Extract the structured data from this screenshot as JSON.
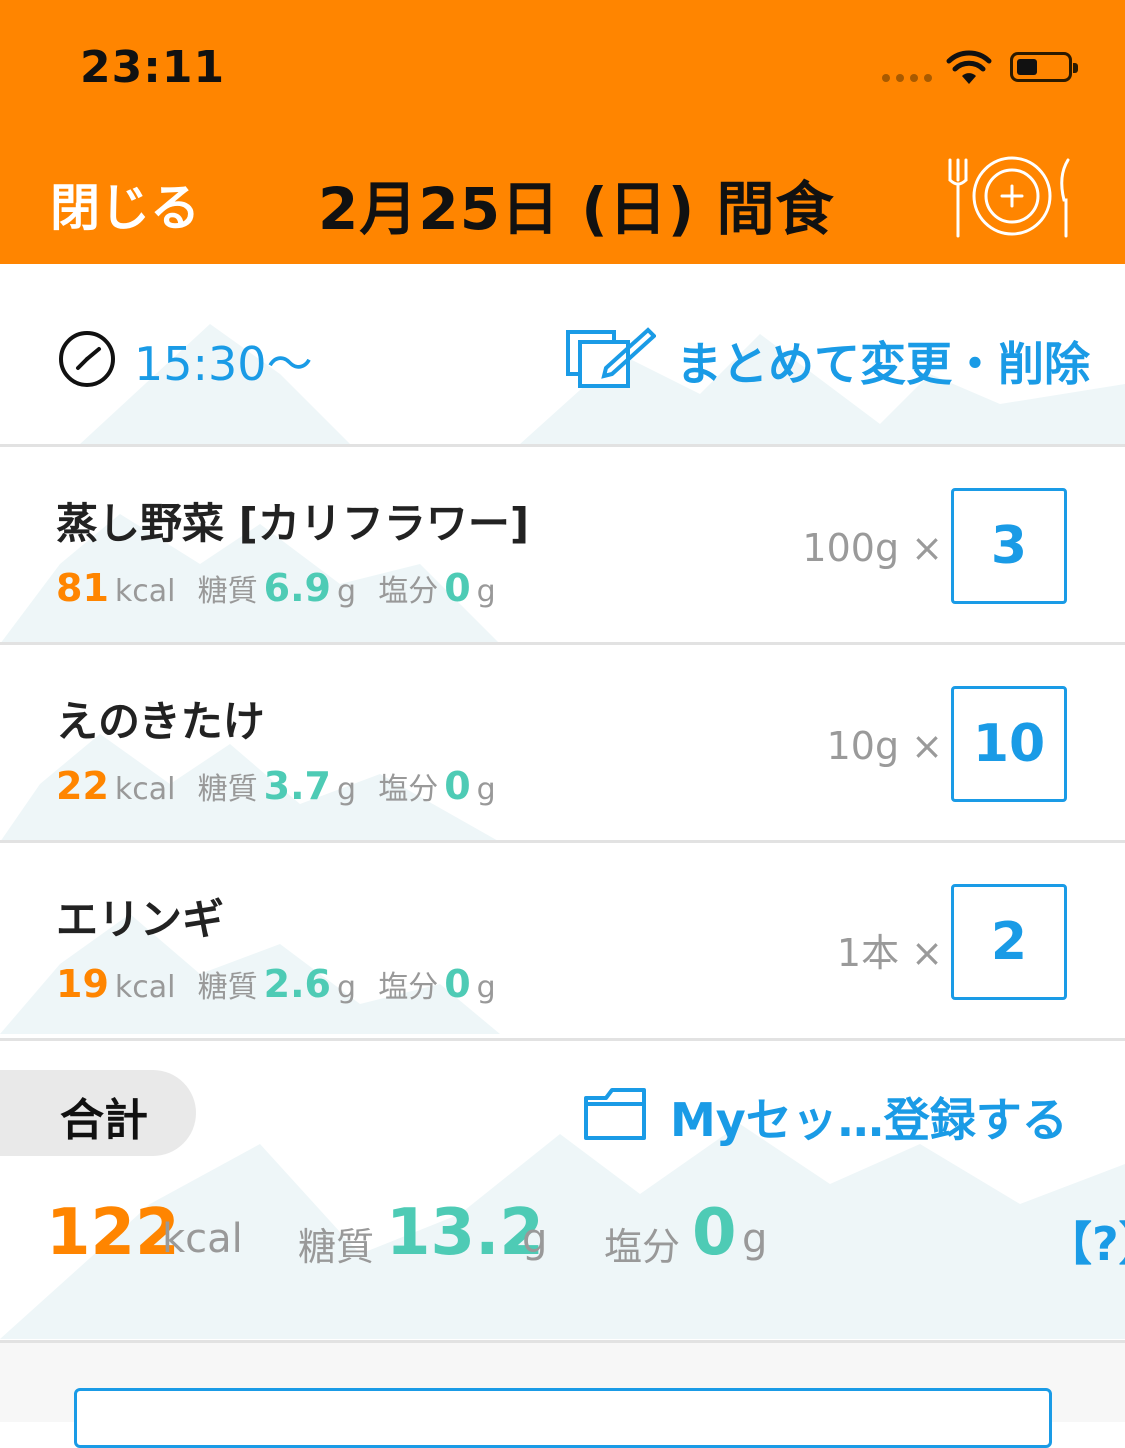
{
  "status_bar": {
    "time": "23:11"
  },
  "header": {
    "close_label": "閉じる",
    "title": "2月25日 (日) 間食",
    "add_icon": "plate-cutlery-plus-icon"
  },
  "meal": {
    "time": "15:30〜",
    "bulk_edit_label": "まとめて変更・削除"
  },
  "labels": {
    "kcal": "kcal",
    "carb": "糖質",
    "salt": "塩分",
    "g": "g"
  },
  "items": [
    {
      "name": "蒸し野菜 [カリフラワー]",
      "kcal": "81",
      "carb": "6.9",
      "salt": "0",
      "unit": "100g ×",
      "qty": "3"
    },
    {
      "name": "えのきたけ",
      "kcal": "22",
      "carb": "3.7",
      "salt": "0",
      "unit": "10g ×",
      "qty": "10"
    },
    {
      "name": "エリンギ",
      "kcal": "19",
      "carb": "2.6",
      "salt": "0",
      "unit": "1本 ×",
      "qty": "2"
    }
  ],
  "total": {
    "label": "合計",
    "myset_label": "Myセッ…登録する",
    "kcal": "122",
    "carb": "13.2",
    "salt": "0",
    "help": "【?】"
  },
  "colors": {
    "header": "#FF8500",
    "accent_blue": "#1A9BE6",
    "kcal_orange": "#FF8500",
    "nutrient_teal": "#4ECBB5"
  }
}
